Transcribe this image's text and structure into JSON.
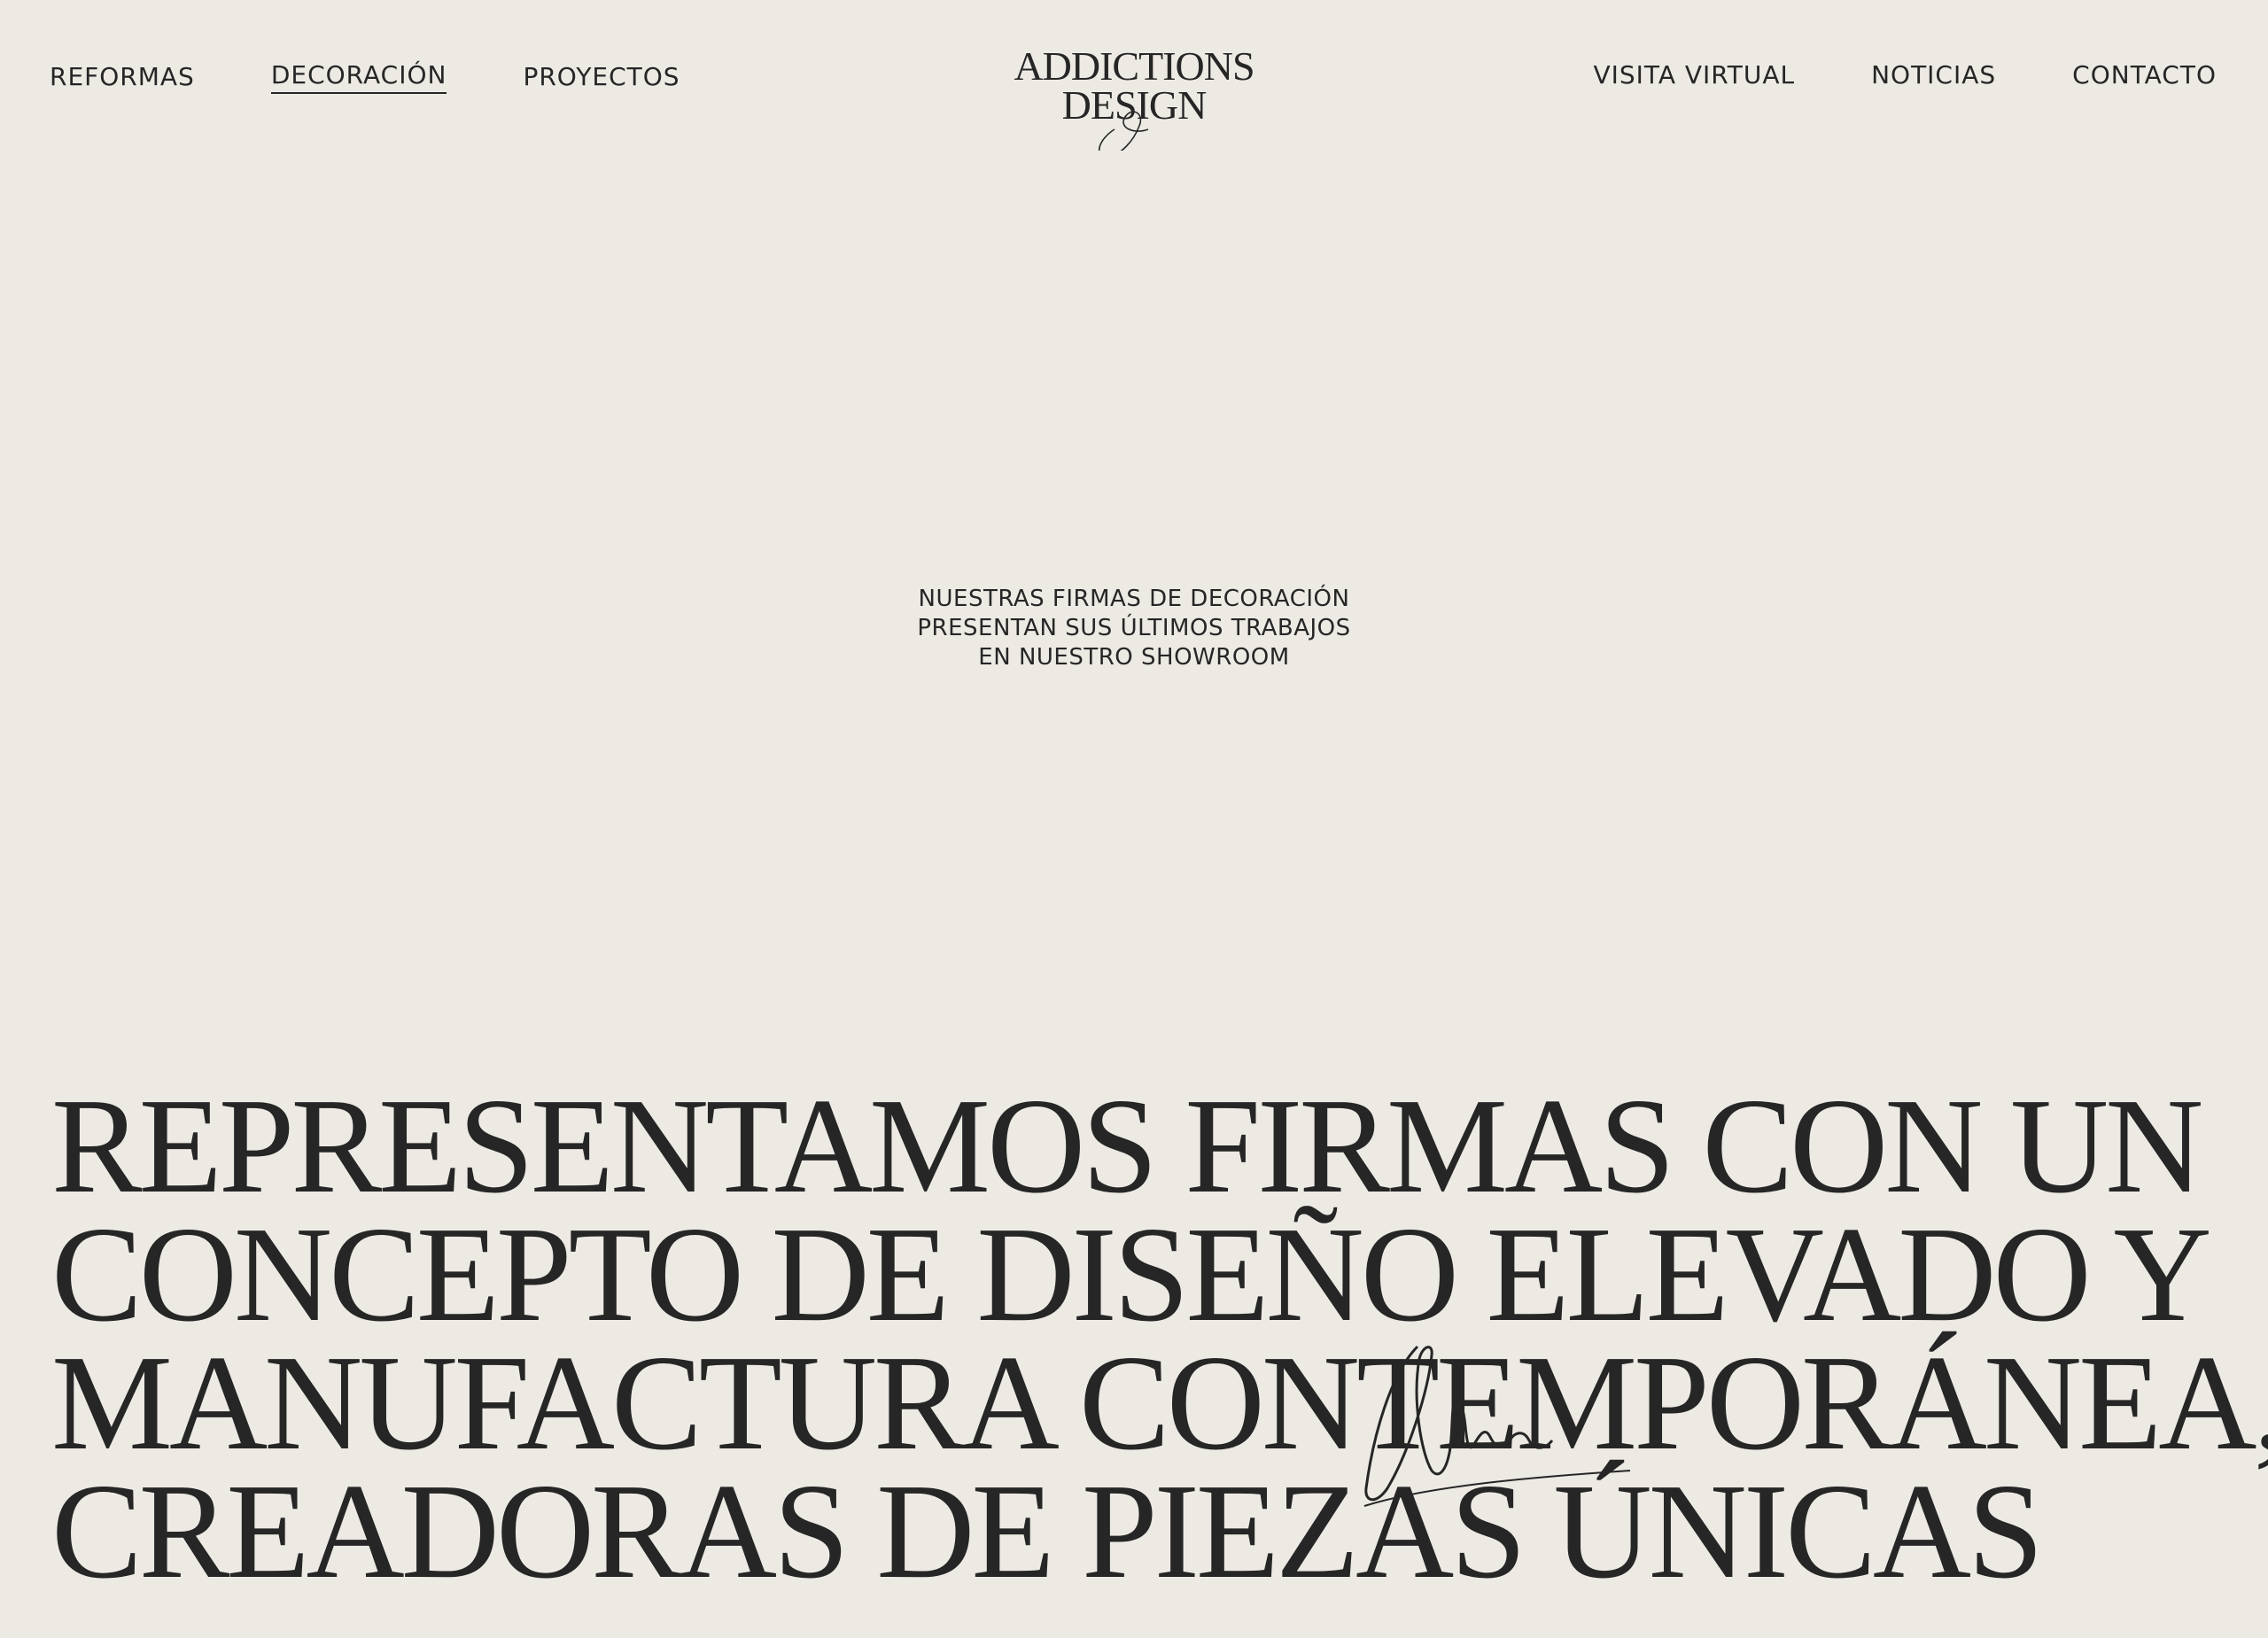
{
  "nav": {
    "left": [
      {
        "label": "REFORMAS"
      },
      {
        "label": "DECORACIÓN",
        "active": true
      },
      {
        "label": "PROYECTOS"
      }
    ],
    "right": [
      {
        "label": "VISITA VIRTUAL"
      },
      {
        "label": "NOTICIAS"
      },
      {
        "label": "CONTACTO"
      }
    ]
  },
  "logo": {
    "line1": "ADDICTIONS",
    "line2": "DESIGN"
  },
  "intro": {
    "lines": [
      "NUESTRAS FIRMAS DE DECORACIÓN",
      "PRESENTAN SUS ÚLTIMOS TRABAJOS",
      "EN NUESTRO SHOWROOM"
    ]
  },
  "headline": {
    "lines": [
      "REPRESENTAMOS FIRMAS CON UN",
      "CONCEPTO DE DISEÑO ELEVADO Y",
      "MANUFACTURA CONTEMPORÁNEA,",
      "CREADORAS DE PIEZAS ÚNICAS"
    ]
  },
  "colors": {
    "background": "#edeae4",
    "text": "#262626"
  }
}
